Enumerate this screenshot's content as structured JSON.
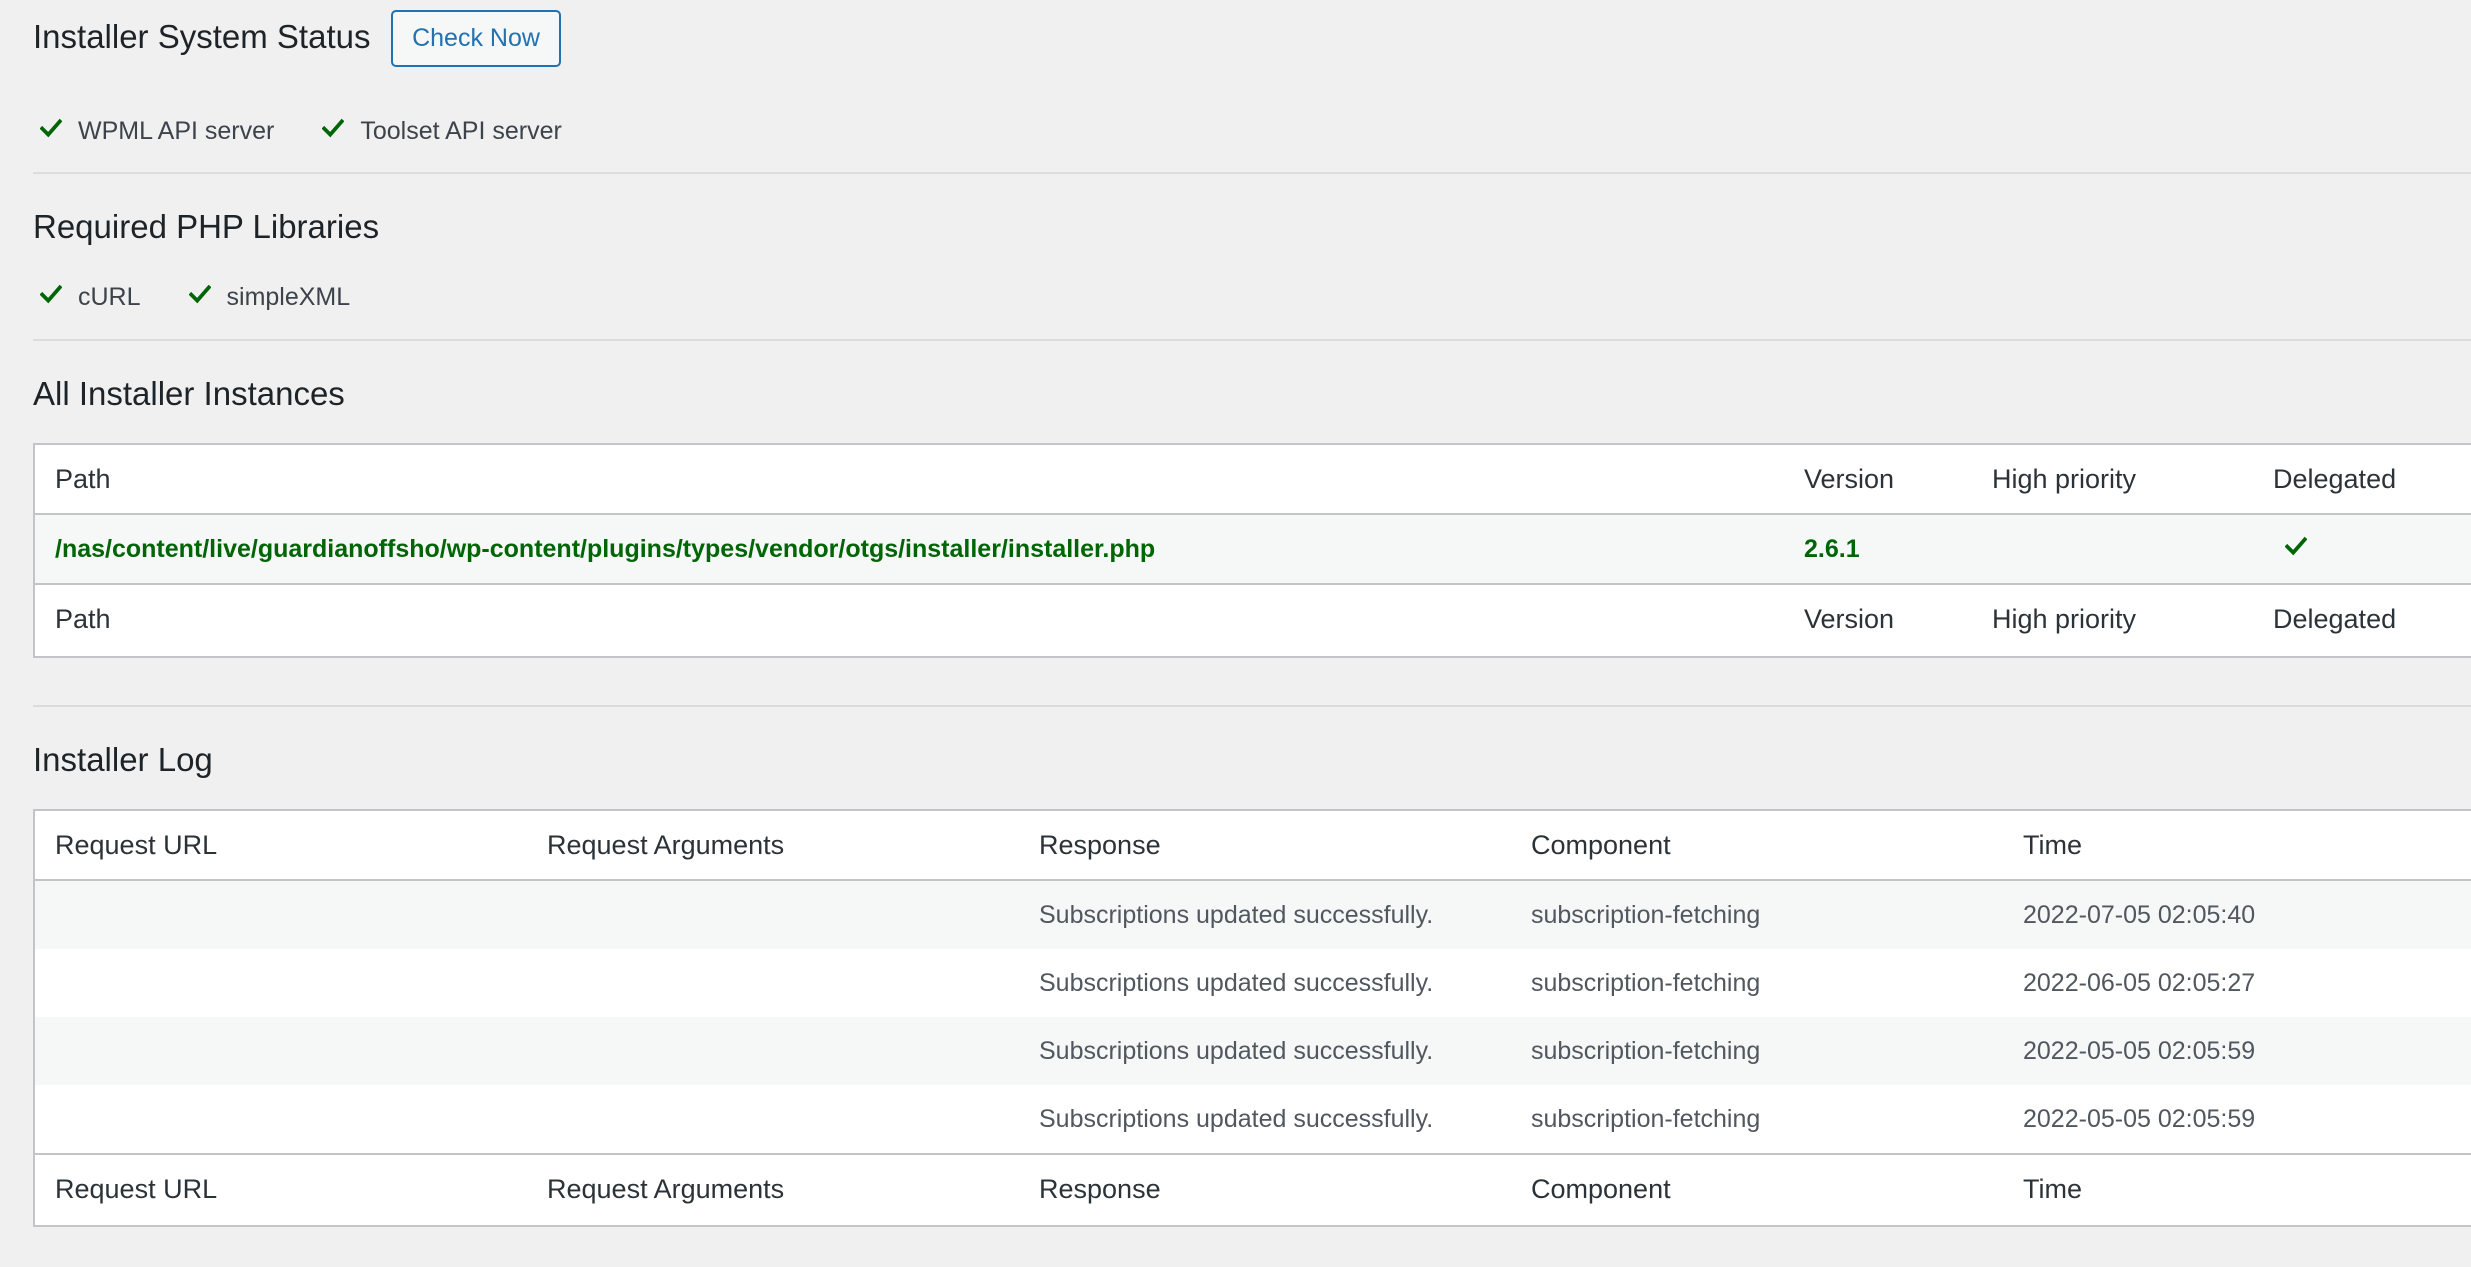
{
  "status": {
    "title": "Installer System Status",
    "check_now_label": "Check Now",
    "servers": [
      {
        "label": "WPML API server",
        "icon": "check-icon"
      },
      {
        "label": "Toolset API server",
        "icon": "check-icon"
      }
    ]
  },
  "php": {
    "title": "Required PHP Libraries",
    "libs": [
      {
        "label": "cURL",
        "icon": "check-icon"
      },
      {
        "label": "simpleXML",
        "icon": "check-icon"
      }
    ]
  },
  "instances": {
    "title": "All Installer Instances",
    "headers": {
      "path": "Path",
      "version": "Version",
      "high_priority": "High priority",
      "delegated": "Delegated"
    },
    "rows": [
      {
        "path": "/nas/content/live/guardianoffsho/wp-content/plugins/types/vendor/otgs/installer/installer.php",
        "version": "2.6.1",
        "high_priority": "",
        "delegated": true
      }
    ]
  },
  "log": {
    "title": "Installer Log",
    "headers": {
      "request_url": "Request URL",
      "request_arguments": "Request Arguments",
      "response": "Response",
      "component": "Component",
      "time": "Time"
    },
    "rows": [
      {
        "request_url": "",
        "request_arguments": "",
        "response": "Subscriptions updated successfully.",
        "component": "subscription-fetching",
        "time": "2022-07-05 02:05:40"
      },
      {
        "request_url": "",
        "request_arguments": "",
        "response": "Subscriptions updated successfully.",
        "component": "subscription-fetching",
        "time": "2022-06-05 02:05:27"
      },
      {
        "request_url": "",
        "request_arguments": "",
        "response": "Subscriptions updated successfully.",
        "component": "subscription-fetching",
        "time": "2022-05-05 02:05:59"
      },
      {
        "request_url": "",
        "request_arguments": "",
        "response": "Subscriptions updated successfully.",
        "component": "subscription-fetching",
        "time": "2022-05-05 02:05:59"
      }
    ]
  },
  "colors": {
    "success_green": "#006505",
    "link_blue": "#2271b1",
    "background": "#f0f0f1"
  }
}
